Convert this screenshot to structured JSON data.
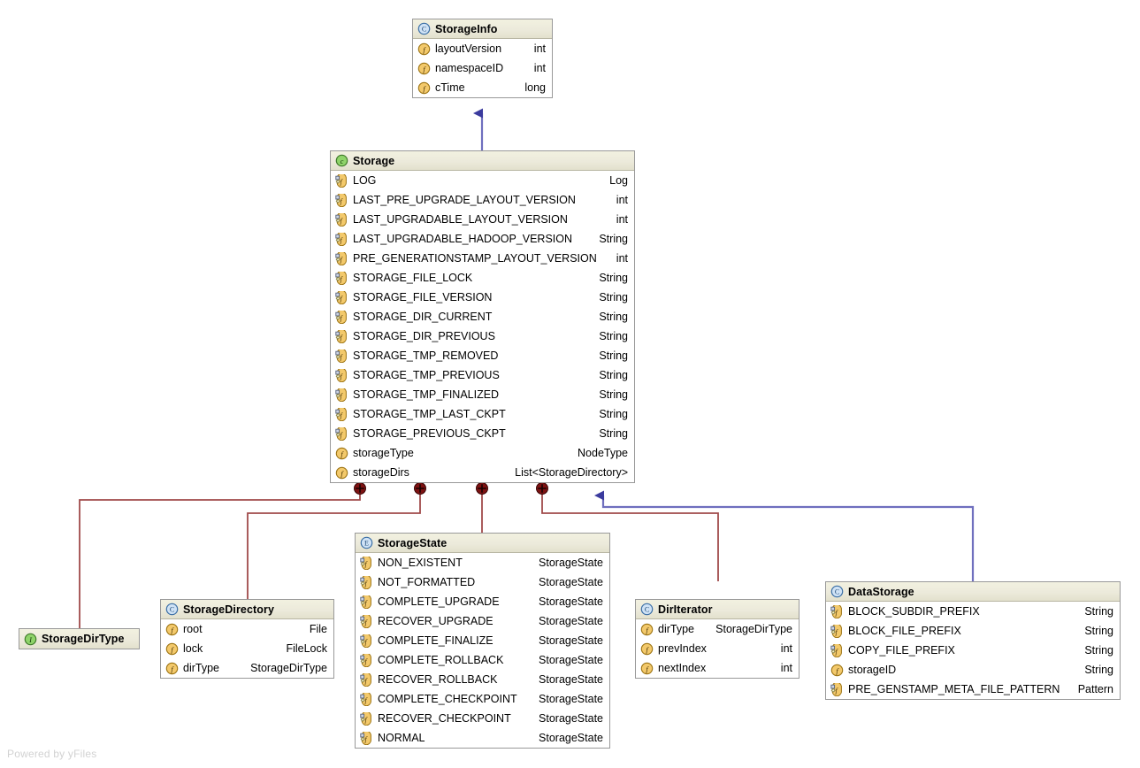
{
  "diagram": {
    "watermark": "Powered by yFiles",
    "background": "#ffffff",
    "edge_colors": {
      "nesting": "#a04a4a",
      "inheritance": "#3b3b9e"
    },
    "icons": {
      "class": "class-icon",
      "abstract_class": "abstract-class-icon",
      "interface": "interface-icon",
      "enum": "enum-icon",
      "field": "field-icon",
      "static_field": "static-field-icon"
    }
  },
  "nodes": {
    "storage_info": {
      "name": "StorageInfo",
      "stereotype": "class",
      "fields": [
        {
          "icon": "field-icon",
          "name": "layoutVersion",
          "type": "int"
        },
        {
          "icon": "field-icon",
          "name": "namespaceID",
          "type": "int"
        },
        {
          "icon": "field-icon",
          "name": "cTime",
          "type": "long"
        }
      ]
    },
    "storage": {
      "name": "Storage",
      "stereotype": "abstract-class",
      "fields": [
        {
          "icon": "static-field-icon",
          "name": "LOG",
          "type": "Log"
        },
        {
          "icon": "static-field-icon",
          "name": "LAST_PRE_UPGRADE_LAYOUT_VERSION",
          "type": "int"
        },
        {
          "icon": "static-field-icon",
          "name": "LAST_UPGRADABLE_LAYOUT_VERSION",
          "type": "int"
        },
        {
          "icon": "static-field-icon",
          "name": "LAST_UPGRADABLE_HADOOP_VERSION",
          "type": "String"
        },
        {
          "icon": "static-field-icon",
          "name": "PRE_GENERATIONSTAMP_LAYOUT_VERSION",
          "type": "int"
        },
        {
          "icon": "static-field-icon",
          "name": "STORAGE_FILE_LOCK",
          "type": "String"
        },
        {
          "icon": "static-field-icon",
          "name": "STORAGE_FILE_VERSION",
          "type": "String"
        },
        {
          "icon": "static-field-icon",
          "name": "STORAGE_DIR_CURRENT",
          "type": "String"
        },
        {
          "icon": "static-field-icon",
          "name": "STORAGE_DIR_PREVIOUS",
          "type": "String"
        },
        {
          "icon": "static-field-icon",
          "name": "STORAGE_TMP_REMOVED",
          "type": "String"
        },
        {
          "icon": "static-field-icon",
          "name": "STORAGE_TMP_PREVIOUS",
          "type": "String"
        },
        {
          "icon": "static-field-icon",
          "name": "STORAGE_TMP_FINALIZED",
          "type": "String"
        },
        {
          "icon": "static-field-icon",
          "name": "STORAGE_TMP_LAST_CKPT",
          "type": "String"
        },
        {
          "icon": "static-field-icon",
          "name": "STORAGE_PREVIOUS_CKPT",
          "type": "String"
        },
        {
          "icon": "field-icon",
          "name": "storageType",
          "type": "NodeType"
        },
        {
          "icon": "field-icon",
          "name": "storageDirs",
          "type": "List<StorageDirectory>"
        }
      ]
    },
    "storage_state": {
      "name": "StorageState",
      "stereotype": "enum",
      "fields": [
        {
          "icon": "static-field-icon",
          "name": "NON_EXISTENT",
          "type": "StorageState"
        },
        {
          "icon": "static-field-icon",
          "name": "NOT_FORMATTED",
          "type": "StorageState"
        },
        {
          "icon": "static-field-icon",
          "name": "COMPLETE_UPGRADE",
          "type": "StorageState"
        },
        {
          "icon": "static-field-icon",
          "name": "RECOVER_UPGRADE",
          "type": "StorageState"
        },
        {
          "icon": "static-field-icon",
          "name": "COMPLETE_FINALIZE",
          "type": "StorageState"
        },
        {
          "icon": "static-field-icon",
          "name": "COMPLETE_ROLLBACK",
          "type": "StorageState"
        },
        {
          "icon": "static-field-icon",
          "name": "RECOVER_ROLLBACK",
          "type": "StorageState"
        },
        {
          "icon": "static-field-icon",
          "name": "COMPLETE_CHECKPOINT",
          "type": "StorageState"
        },
        {
          "icon": "static-field-icon",
          "name": "RECOVER_CHECKPOINT",
          "type": "StorageState"
        },
        {
          "icon": "static-field-icon",
          "name": "NORMAL",
          "type": "StorageState"
        }
      ]
    },
    "storage_directory": {
      "name": "StorageDirectory",
      "stereotype": "class",
      "fields": [
        {
          "icon": "field-icon",
          "name": "root",
          "type": "File"
        },
        {
          "icon": "field-icon",
          "name": "lock",
          "type": "FileLock"
        },
        {
          "icon": "field-icon",
          "name": "dirType",
          "type": "StorageDirType"
        }
      ]
    },
    "storage_dir_type": {
      "name": "StorageDirType",
      "stereotype": "interface",
      "fields": []
    },
    "dir_iterator": {
      "name": "DirIterator",
      "stereotype": "class",
      "fields": [
        {
          "icon": "field-icon",
          "name": "dirType",
          "type": "StorageDirType"
        },
        {
          "icon": "field-icon",
          "name": "prevIndex",
          "type": "int"
        },
        {
          "icon": "field-icon",
          "name": "nextIndex",
          "type": "int"
        }
      ]
    },
    "data_storage": {
      "name": "DataStorage",
      "stereotype": "class",
      "fields": [
        {
          "icon": "static-field-icon",
          "name": "BLOCK_SUBDIR_PREFIX",
          "type": "String"
        },
        {
          "icon": "static-field-icon",
          "name": "BLOCK_FILE_PREFIX",
          "type": "String"
        },
        {
          "icon": "static-field-icon",
          "name": "COPY_FILE_PREFIX",
          "type": "String"
        },
        {
          "icon": "field-icon",
          "name": "storageID",
          "type": "String"
        },
        {
          "icon": "static-field-icon",
          "name": "PRE_GENSTAMP_META_FILE_PATTERN",
          "type": "Pattern"
        }
      ]
    }
  },
  "edges": [
    {
      "from": "storage",
      "to": "storage_info",
      "kind": "inheritance"
    },
    {
      "from": "data_storage",
      "to": "storage",
      "kind": "inheritance"
    },
    {
      "from": "storage",
      "to": "storage_dir_type",
      "kind": "nesting"
    },
    {
      "from": "storage",
      "to": "storage_directory",
      "kind": "nesting"
    },
    {
      "from": "storage",
      "to": "storage_state",
      "kind": "nesting"
    },
    {
      "from": "storage",
      "to": "dir_iterator",
      "kind": "nesting"
    }
  ]
}
